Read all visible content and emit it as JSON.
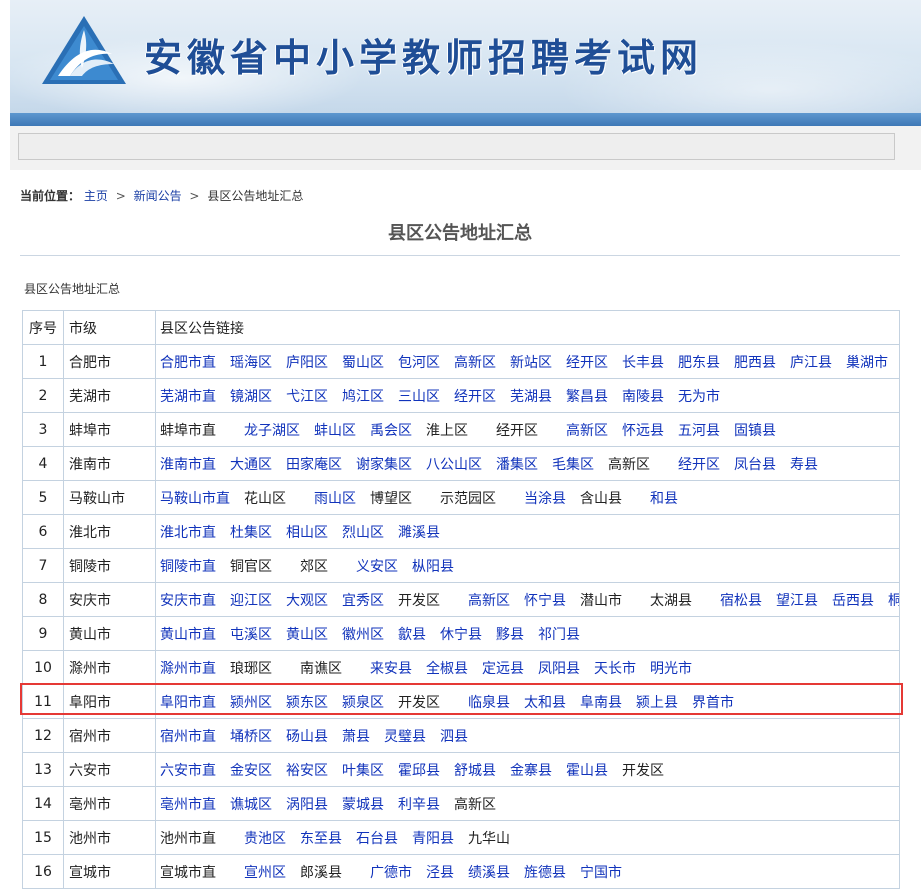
{
  "site": {
    "title": "安徽省中小学教师招聘考试网"
  },
  "breadcrumb": {
    "label": "当前位置：",
    "items": [
      {
        "text": "主页",
        "link": true
      },
      {
        "text": "新闻公告",
        "link": true
      },
      {
        "text": "县区公告地址汇总",
        "link": false
      }
    ],
    "separator": ">"
  },
  "article": {
    "title": "县区公告地址汇总",
    "subheading": "县区公告地址汇总"
  },
  "table": {
    "headers": [
      "序号",
      "市级",
      "县区公告链接"
    ],
    "rows": [
      {
        "no": "1",
        "city": "合肥市",
        "items": [
          {
            "t": "合肥市直",
            "l": true
          },
          {
            "t": "瑶海区",
            "l": true
          },
          {
            "t": "庐阳区",
            "l": true
          },
          {
            "t": "蜀山区",
            "l": true
          },
          {
            "t": "包河区",
            "l": true
          },
          {
            "t": "高新区",
            "l": true
          },
          {
            "t": "新站区",
            "l": true
          },
          {
            "t": "经开区",
            "l": true
          },
          {
            "t": "长丰县",
            "l": true
          },
          {
            "t": "肥东县",
            "l": true
          },
          {
            "t": "肥西县",
            "l": true
          },
          {
            "t": "庐江县",
            "l": true
          },
          {
            "t": "巢湖市",
            "l": true
          }
        ]
      },
      {
        "no": "2",
        "city": "芜湖市",
        "items": [
          {
            "t": "芜湖市直",
            "l": true
          },
          {
            "t": "镜湖区",
            "l": true
          },
          {
            "t": "弋江区",
            "l": true
          },
          {
            "t": "鸠江区",
            "l": true
          },
          {
            "t": "三山区",
            "l": true
          },
          {
            "t": "经开区",
            "l": true
          },
          {
            "t": "芜湖县",
            "l": true
          },
          {
            "t": "繁昌县",
            "l": true
          },
          {
            "t": "南陵县",
            "l": true
          },
          {
            "t": "无为市",
            "l": true
          }
        ]
      },
      {
        "no": "3",
        "city": "蚌埠市",
        "items": [
          {
            "t": "蚌埠市直",
            "l": false
          },
          {
            "t": "龙子湖区",
            "l": true
          },
          {
            "t": "蚌山区",
            "l": true
          },
          {
            "t": "禹会区",
            "l": true
          },
          {
            "t": "淮上区",
            "l": false
          },
          {
            "t": "经开区",
            "l": false
          },
          {
            "t": "高新区",
            "l": true
          },
          {
            "t": "怀远县",
            "l": true
          },
          {
            "t": "五河县",
            "l": true
          },
          {
            "t": "固镇县",
            "l": true
          }
        ]
      },
      {
        "no": "4",
        "city": "淮南市",
        "items": [
          {
            "t": "淮南市直",
            "l": true
          },
          {
            "t": "大通区",
            "l": true
          },
          {
            "t": "田家庵区",
            "l": true
          },
          {
            "t": "谢家集区",
            "l": true
          },
          {
            "t": "八公山区",
            "l": true
          },
          {
            "t": "潘集区",
            "l": true
          },
          {
            "t": "毛集区",
            "l": true
          },
          {
            "t": "高新区",
            "l": false
          },
          {
            "t": "经开区",
            "l": true
          },
          {
            "t": "凤台县",
            "l": true
          },
          {
            "t": "寿县",
            "l": true
          }
        ]
      },
      {
        "no": "5",
        "city": "马鞍山市",
        "items": [
          {
            "t": "马鞍山市直",
            "l": true
          },
          {
            "t": "花山区",
            "l": false
          },
          {
            "t": "雨山区",
            "l": true
          },
          {
            "t": "博望区",
            "l": false
          },
          {
            "t": "示范园区",
            "l": false
          },
          {
            "t": "当涂县",
            "l": true
          },
          {
            "t": "含山县",
            "l": false
          },
          {
            "t": "和县",
            "l": true
          }
        ]
      },
      {
        "no": "6",
        "city": "淮北市",
        "items": [
          {
            "t": "淮北市直",
            "l": true
          },
          {
            "t": "杜集区",
            "l": true
          },
          {
            "t": "相山区",
            "l": true
          },
          {
            "t": "烈山区",
            "l": true
          },
          {
            "t": "濉溪县",
            "l": true
          }
        ]
      },
      {
        "no": "7",
        "city": "铜陵市",
        "items": [
          {
            "t": "铜陵市直",
            "l": true
          },
          {
            "t": "铜官区",
            "l": false
          },
          {
            "t": "郊区",
            "l": false
          },
          {
            "t": "义安区",
            "l": true
          },
          {
            "t": "枞阳县",
            "l": true
          }
        ]
      },
      {
        "no": "8",
        "city": "安庆市",
        "items": [
          {
            "t": "安庆市直",
            "l": true
          },
          {
            "t": "迎江区",
            "l": true
          },
          {
            "t": "大观区",
            "l": true
          },
          {
            "t": "宜秀区",
            "l": true
          },
          {
            "t": "开发区",
            "l": false
          },
          {
            "t": "高新区",
            "l": true
          },
          {
            "t": "怀宁县",
            "l": true
          },
          {
            "t": "潜山市",
            "l": false
          },
          {
            "t": "太湖县",
            "l": false
          },
          {
            "t": "宿松县",
            "l": true
          },
          {
            "t": "望江县",
            "l": true
          },
          {
            "t": "岳西县",
            "l": true
          },
          {
            "t": "桐城市",
            "l": true
          }
        ]
      },
      {
        "no": "9",
        "city": "黄山市",
        "items": [
          {
            "t": "黄山市直",
            "l": true
          },
          {
            "t": "屯溪区",
            "l": true
          },
          {
            "t": "黄山区",
            "l": true
          },
          {
            "t": "徽州区",
            "l": true
          },
          {
            "t": "歙县",
            "l": true
          },
          {
            "t": "休宁县",
            "l": true
          },
          {
            "t": "黟县",
            "l": true
          },
          {
            "t": "祁门县",
            "l": true
          }
        ]
      },
      {
        "no": "10",
        "city": "滁州市",
        "items": [
          {
            "t": "滁州市直",
            "l": true
          },
          {
            "t": "琅琊区",
            "l": false
          },
          {
            "t": "南谯区",
            "l": false
          },
          {
            "t": "来安县",
            "l": true
          },
          {
            "t": "全椒县",
            "l": true
          },
          {
            "t": "定远县",
            "l": true
          },
          {
            "t": "凤阳县",
            "l": true
          },
          {
            "t": "天长市",
            "l": true
          },
          {
            "t": "明光市",
            "l": true
          }
        ]
      },
      {
        "no": "11",
        "city": "阜阳市",
        "items": [
          {
            "t": "阜阳市直",
            "l": true
          },
          {
            "t": "颍州区",
            "l": true
          },
          {
            "t": "颍东区",
            "l": true
          },
          {
            "t": "颍泉区",
            "l": true
          },
          {
            "t": "开发区",
            "l": false
          },
          {
            "t": "临泉县",
            "l": true
          },
          {
            "t": "太和县",
            "l": true
          },
          {
            "t": "阜南县",
            "l": true
          },
          {
            "t": "颍上县",
            "l": true
          },
          {
            "t": "界首市",
            "l": true
          }
        ]
      },
      {
        "no": "12",
        "city": "宿州市",
        "items": [
          {
            "t": "宿州市直",
            "l": true
          },
          {
            "t": "埇桥区",
            "l": true
          },
          {
            "t": "砀山县",
            "l": true
          },
          {
            "t": "萧县",
            "l": true
          },
          {
            "t": "灵璧县",
            "l": true
          },
          {
            "t": "泗县",
            "l": true
          }
        ]
      },
      {
        "no": "13",
        "city": "六安市",
        "items": [
          {
            "t": "六安市直",
            "l": true
          },
          {
            "t": "金安区",
            "l": true
          },
          {
            "t": "裕安区",
            "l": true
          },
          {
            "t": "叶集区",
            "l": true
          },
          {
            "t": "霍邱县",
            "l": true
          },
          {
            "t": "舒城县",
            "l": true
          },
          {
            "t": "金寨县",
            "l": true
          },
          {
            "t": "霍山县",
            "l": true
          },
          {
            "t": "开发区",
            "l": false
          }
        ]
      },
      {
        "no": "14",
        "city": "亳州市",
        "items": [
          {
            "t": "亳州市直",
            "l": true
          },
          {
            "t": "谯城区",
            "l": true
          },
          {
            "t": "涡阳县",
            "l": true
          },
          {
            "t": "蒙城县",
            "l": true
          },
          {
            "t": "利辛县",
            "l": true
          },
          {
            "t": "高新区",
            "l": false
          }
        ]
      },
      {
        "no": "15",
        "city": "池州市",
        "items": [
          {
            "t": "池州市直",
            "l": false
          },
          {
            "t": "贵池区",
            "l": true
          },
          {
            "t": "东至县",
            "l": true
          },
          {
            "t": "石台县",
            "l": true
          },
          {
            "t": "青阳县",
            "l": true
          },
          {
            "t": "九华山",
            "l": false
          }
        ]
      },
      {
        "no": "16",
        "city": "宣城市",
        "items": [
          {
            "t": "宣城市直",
            "l": false
          },
          {
            "t": "宣州区",
            "l": true
          },
          {
            "t": "郎溪县",
            "l": false
          },
          {
            "t": "广德市",
            "l": true
          },
          {
            "t": "泾县",
            "l": true
          },
          {
            "t": "绩溪县",
            "l": true
          },
          {
            "t": "旌德县",
            "l": true
          },
          {
            "t": "宁国市",
            "l": true
          }
        ]
      }
    ],
    "highlighted_row": "11"
  },
  "colors": {
    "link": "#1133bb",
    "brand": "#1f4e96",
    "highlight": "#e53935",
    "bar": "#3e78b6"
  }
}
